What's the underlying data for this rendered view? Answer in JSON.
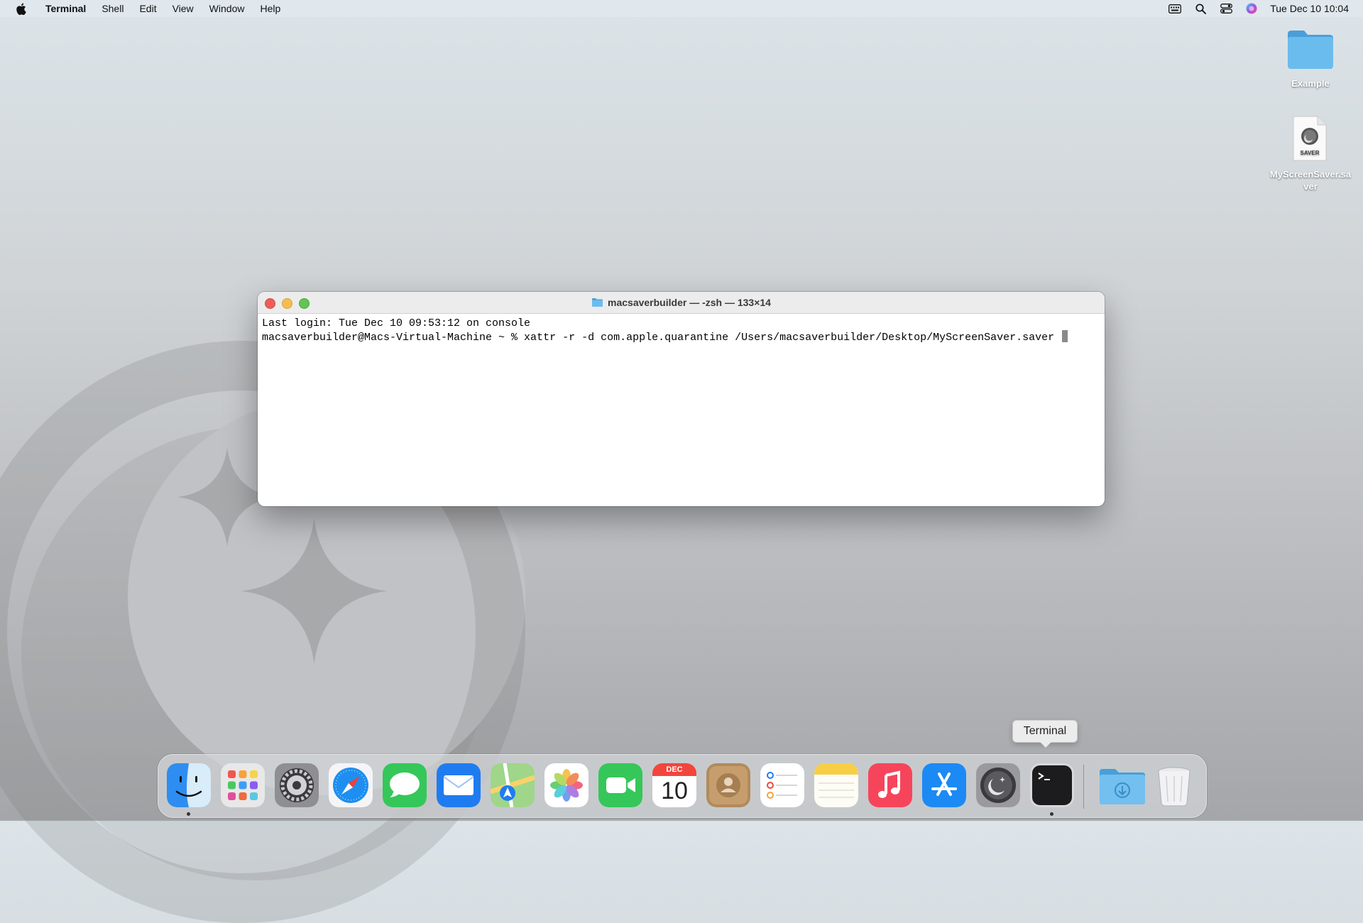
{
  "menubar": {
    "app_name": "Terminal",
    "menus": [
      "Shell",
      "Edit",
      "View",
      "Window",
      "Help"
    ],
    "clock": "Tue Dec 10  10:04"
  },
  "desktop": {
    "icons": [
      {
        "label": "Example",
        "icon": "folder-icon"
      },
      {
        "label": "MyScreenSaver.saver",
        "icon": "screensaver-file-icon",
        "badge": "SAVER"
      }
    ]
  },
  "terminal": {
    "title": "macsaverbuilder — -zsh — 133×14",
    "lines": [
      "Last login: Tue Dec 10 09:53:12 on console",
      "macsaverbuilder@Macs-Virtual-Machine ~ % xattr -r -d com.apple.quarantine /Users/macsaverbuilder/Desktop/MyScreenSaver.saver "
    ]
  },
  "tooltip": {
    "text": "Terminal"
  },
  "dock": {
    "calendar": {
      "month": "DEC",
      "day": "10"
    },
    "apps": [
      "Finder",
      "Launchpad",
      "System Settings",
      "Safari",
      "Messages",
      "Mail",
      "Maps",
      "Photos",
      "FaceTime",
      "Calendar",
      "Contacts",
      "Reminders",
      "Notes",
      "Music",
      "App Store",
      "Screen Saver",
      "Terminal",
      "Downloads",
      "Trash"
    ],
    "running": [
      "Finder",
      "Terminal"
    ]
  },
  "colors": {
    "close": "#ec5f57",
    "minimize": "#f4be4f",
    "maximize": "#61c454",
    "folder": "#5fb1e8"
  }
}
